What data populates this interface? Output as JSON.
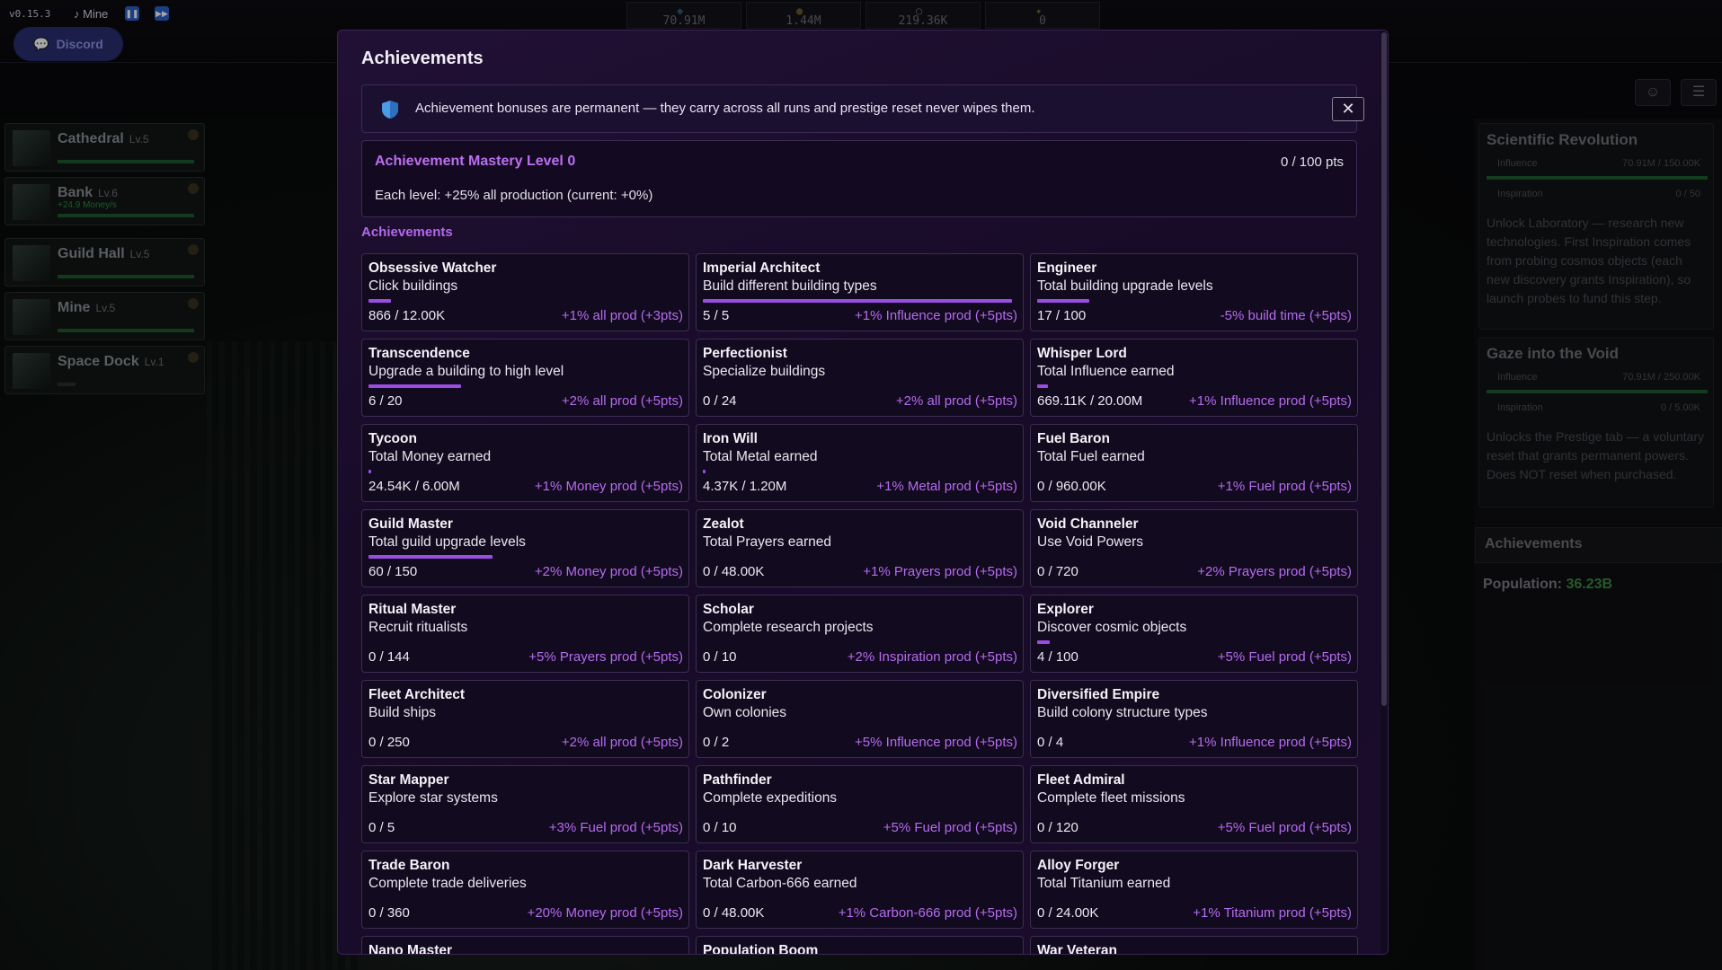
{
  "topbar": {
    "version": "v0.15.3",
    "music": "♪ Mine",
    "pause_icon": "pause-icon",
    "skip_icon": "fast-forward-icon",
    "discord_label": "Discord",
    "resources": [
      {
        "icon": "gem-icon",
        "glyph": "◆",
        "value": "70.91M"
      },
      {
        "icon": "money-bag-icon",
        "glyph": "●",
        "value": "1.44M"
      },
      {
        "icon": "gear-icon",
        "glyph": "○",
        "value": "219.36K"
      },
      {
        "icon": "sparkle-icon",
        "glyph": "✦",
        "value": "0"
      }
    ]
  },
  "buildings": [
    {
      "name": "Cathedral",
      "level": "Lv.5",
      "rate": ""
    },
    {
      "name": "Bank",
      "level": "Lv.6",
      "rate": "+24.9 Money/s"
    },
    {
      "name": "Guild Hall",
      "level": "Lv.5",
      "rate": ""
    },
    {
      "name": "Mine",
      "level": "Lv.5",
      "rate": ""
    },
    {
      "name": "Space Dock",
      "level": "Lv.1",
      "rate": ""
    }
  ],
  "right_panel": {
    "quests": [
      {
        "title": "Scientific Revolution",
        "req1_label": "Influence",
        "req1_value": "70.91M / 150.00K",
        "req2_label": "Inspiration",
        "req2_value": "0 / 50",
        "desc": "Unlock Laboratory — research new technologies. First Inspiration comes from probing cosmos objects (each new discovery grants Inspiration), so launch probes to fund this step."
      },
      {
        "title": "Gaze into the Void",
        "req1_label": "Influence",
        "req1_value": "70.91M / 250.00K",
        "req2_label": "Inspiration",
        "req2_value": "0 / 5.00K",
        "desc": "Unlocks the Prestige tab — a voluntary reset that grants permanent powers. Does NOT reset when purchased."
      }
    ],
    "achievements_label": "Achievements",
    "population_label": "Population:",
    "population_value": "36.23B"
  },
  "modal": {
    "title": "Achievements",
    "info": "Achievement bonuses are permanent — they carry across all runs and prestige reset never wipes them.",
    "close_glyph": "✕",
    "mastery_title": "Achievement Mastery Level 0",
    "mastery_points": "0 / 100 pts",
    "mastery_desc": "Each level: +25% all production (current: +0%)",
    "section_label": "Achievements",
    "achievements": [
      {
        "name": "Obsessive Watcher",
        "desc": "Click buildings",
        "progress": "866 / 12.00K",
        "reward": "+1% all prod (+3pts)",
        "fraction": 0.0722
      },
      {
        "name": "Imperial Architect",
        "desc": "Build different building types",
        "progress": "5 / 5",
        "reward": "+1% Influence prod (+5pts)",
        "fraction": 1.0
      },
      {
        "name": "Engineer",
        "desc": "Total building upgrade levels",
        "progress": "17 / 100",
        "reward": "-5% build time (+5pts)",
        "fraction": 0.17
      },
      {
        "name": "Transcendence",
        "desc": "Upgrade a building to high level",
        "progress": "6 / 20",
        "reward": "+2% all prod (+5pts)",
        "fraction": 0.3
      },
      {
        "name": "Perfectionist",
        "desc": "Specialize buildings",
        "progress": "0 / 24",
        "reward": "+2% all prod (+5pts)",
        "fraction": 0
      },
      {
        "name": "Whisper Lord",
        "desc": "Total Influence earned",
        "progress": "669.11K / 20.00M",
        "reward": "+1% Influence prod (+5pts)",
        "fraction": 0.0335
      },
      {
        "name": "Tycoon",
        "desc": "Total Money earned",
        "progress": "24.54K / 6.00M",
        "reward": "+1% Money prod (+5pts)",
        "fraction": 0.0041
      },
      {
        "name": "Iron Will",
        "desc": "Total Metal earned",
        "progress": "4.37K / 1.20M",
        "reward": "+1% Metal prod (+5pts)",
        "fraction": 0.0036
      },
      {
        "name": "Fuel Baron",
        "desc": "Total Fuel earned",
        "progress": "0 / 960.00K",
        "reward": "+1% Fuel prod (+5pts)",
        "fraction": 0
      },
      {
        "name": "Guild Master",
        "desc": "Total guild upgrade levels",
        "progress": "60 / 150",
        "reward": "+2% Money prod (+5pts)",
        "fraction": 0.4
      },
      {
        "name": "Zealot",
        "desc": "Total Prayers earned",
        "progress": "0 / 48.00K",
        "reward": "+1% Prayers prod (+5pts)",
        "fraction": 0
      },
      {
        "name": "Void Channeler",
        "desc": "Use Void Powers",
        "progress": "0 / 720",
        "reward": "+2% Prayers prod (+5pts)",
        "fraction": 0
      },
      {
        "name": "Ritual Master",
        "desc": "Recruit ritualists",
        "progress": "0 / 144",
        "reward": "+5% Prayers prod (+5pts)",
        "fraction": 0
      },
      {
        "name": "Scholar",
        "desc": "Complete research projects",
        "progress": "0 / 10",
        "reward": "+2% Inspiration prod (+5pts)",
        "fraction": 0
      },
      {
        "name": "Explorer",
        "desc": "Discover cosmic objects",
        "progress": "4 / 100",
        "reward": "+5% Fuel prod (+5pts)",
        "fraction": 0.04
      },
      {
        "name": "Fleet Architect",
        "desc": "Build ships",
        "progress": "0 / 250",
        "reward": "+2% all prod (+5pts)",
        "fraction": 0
      },
      {
        "name": "Colonizer",
        "desc": "Own colonies",
        "progress": "0 / 2",
        "reward": "+5% Influence prod (+5pts)",
        "fraction": 0
      },
      {
        "name": "Diversified Empire",
        "desc": "Build colony structure types",
        "progress": "0 / 4",
        "reward": "+1% Influence prod (+5pts)",
        "fraction": 0
      },
      {
        "name": "Star Mapper",
        "desc": "Explore star systems",
        "progress": "0 / 5",
        "reward": "+3% Fuel prod (+5pts)",
        "fraction": 0
      },
      {
        "name": "Pathfinder",
        "desc": "Complete expeditions",
        "progress": "0 / 10",
        "reward": "+5% Fuel prod (+5pts)",
        "fraction": 0
      },
      {
        "name": "Fleet Admiral",
        "desc": "Complete fleet missions",
        "progress": "0 / 120",
        "reward": "+5% Fuel prod (+5pts)",
        "fraction": 0
      },
      {
        "name": "Trade Baron",
        "desc": "Complete trade deliveries",
        "progress": "0 / 360",
        "reward": "+20% Money prod (+5pts)",
        "fraction": 0
      },
      {
        "name": "Dark Harvester",
        "desc": "Total Carbon-666 earned",
        "progress": "0 / 48.00K",
        "reward": "+1% Carbon-666 prod (+5pts)",
        "fraction": 0
      },
      {
        "name": "Alloy Forger",
        "desc": "Total Titanium earned",
        "progress": "0 / 24.00K",
        "reward": "+1% Titanium prod (+5pts)",
        "fraction": 0
      },
      {
        "name": "Nano Master",
        "desc": "",
        "progress": "",
        "reward": "",
        "fraction": 0
      },
      {
        "name": "Population Boom",
        "desc": "",
        "progress": "",
        "reward": "",
        "fraction": 0
      },
      {
        "name": "War Veteran",
        "desc": "",
        "progress": "",
        "reward": "",
        "fraction": 0
      }
    ]
  }
}
